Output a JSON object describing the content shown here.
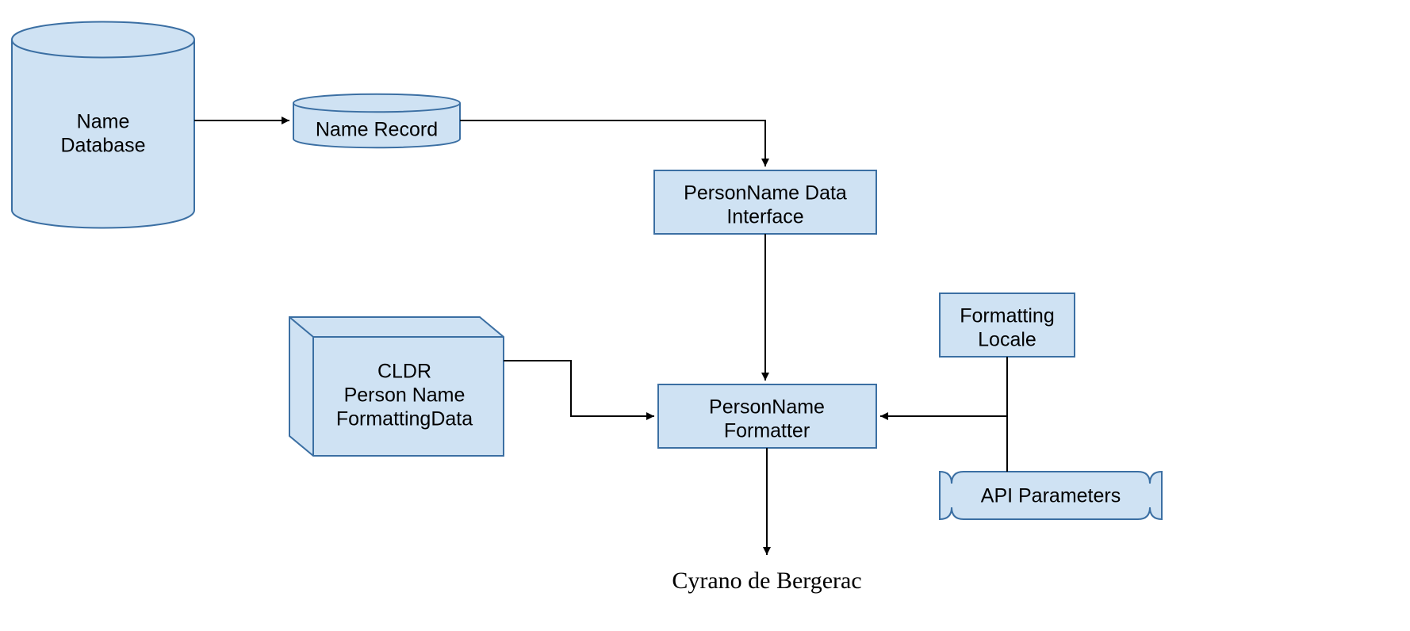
{
  "nodes": {
    "name_database": {
      "line1": "Name",
      "line2": "Database"
    },
    "name_record": {
      "line1": "Name Record"
    },
    "person_name_data_interface": {
      "line1": "PersonName Data",
      "line2": "Interface"
    },
    "cldr_formatting_data": {
      "line1": "CLDR",
      "line2": "Person Name",
      "line3": "FormattingData"
    },
    "person_name_formatter": {
      "line1": "PersonName",
      "line2": "Formatter"
    },
    "formatting_locale": {
      "line1": "Formatting",
      "line2": "Locale"
    },
    "api_parameters": {
      "line1": "API Parameters"
    }
  },
  "output": {
    "text": "Cyrano de Bergerac"
  },
  "colors": {
    "node_fill": "#cfe2f3",
    "node_stroke": "#3b6fa3",
    "arrow": "#000000"
  }
}
